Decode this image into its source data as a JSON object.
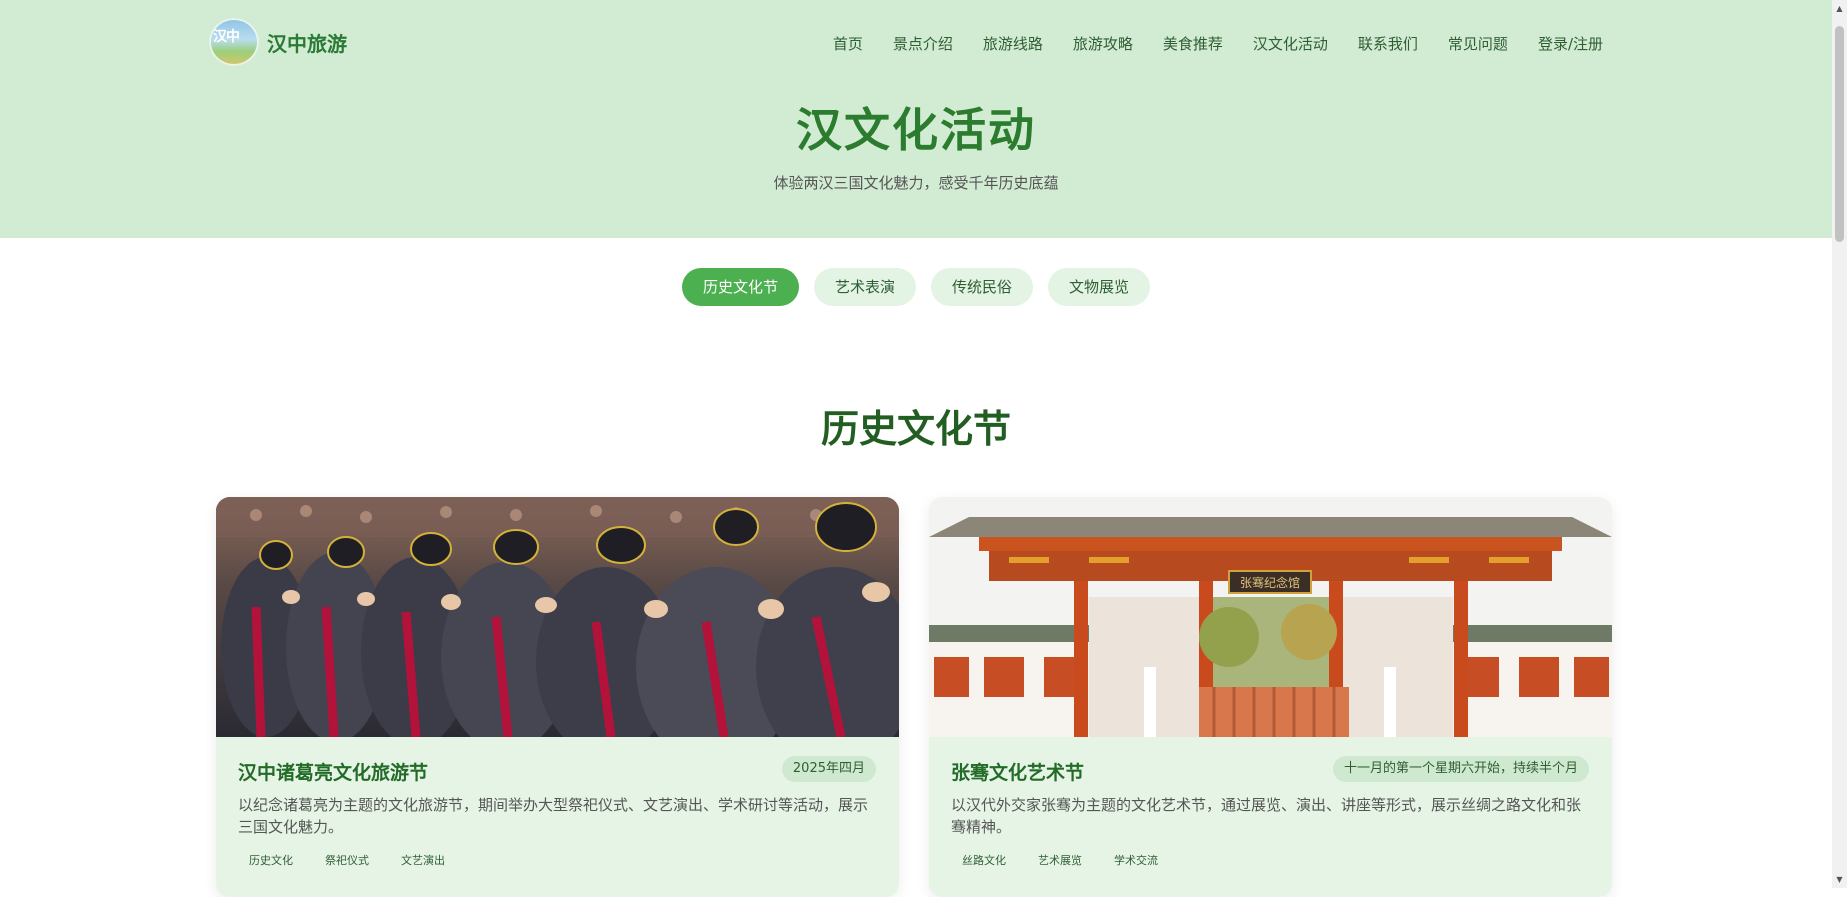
{
  "brand": {
    "name": "汉中旅游",
    "badge_text": "汉中"
  },
  "nav": [
    {
      "label": "首页"
    },
    {
      "label": "景点介绍"
    },
    {
      "label": "旅游线路"
    },
    {
      "label": "旅游攻略"
    },
    {
      "label": "美食推荐"
    },
    {
      "label": "汉文化活动"
    },
    {
      "label": "联系我们"
    },
    {
      "label": "常见问题"
    },
    {
      "label": "登录/注册"
    }
  ],
  "hero": {
    "title": "汉文化活动",
    "subtitle": "体验两汉三国文化魅力，感受千年历史底蕴"
  },
  "tabs": [
    {
      "label": "历史文化节",
      "active": true
    },
    {
      "label": "艺术表演",
      "active": false
    },
    {
      "label": "传统民俗",
      "active": false
    },
    {
      "label": "文物展览",
      "active": false
    }
  ],
  "section": {
    "title": "历史文化节"
  },
  "cards": [
    {
      "title": "汉中诸葛亮文化旅游节",
      "date": "2025年四月",
      "description": "以纪念诸葛亮为主题的文化旅游节，期间举办大型祭祀仪式、文艺演出、学术研讨等活动，展示三国文化魅力。",
      "tags": [
        "历史文化",
        "祭祀仪式",
        "文艺演出"
      ]
    },
    {
      "title": "张骞文化艺术节",
      "date": "十一月的第一个星期六开始，持续半个月",
      "description": "以汉代外交家张骞为主题的文化艺术节，通过展览、演出、讲座等形式，展示丝绸之路文化和张骞精神。",
      "tags": [
        "丝路文化",
        "艺术展览",
        "学术交流"
      ],
      "gate_plaque": "张骞纪念馆"
    }
  ],
  "colors": {
    "hero_bg": "#d2ecd3",
    "accent": "#4caf50",
    "title_green": "#2b7c2e",
    "card_bg": "#e6f4e6"
  }
}
